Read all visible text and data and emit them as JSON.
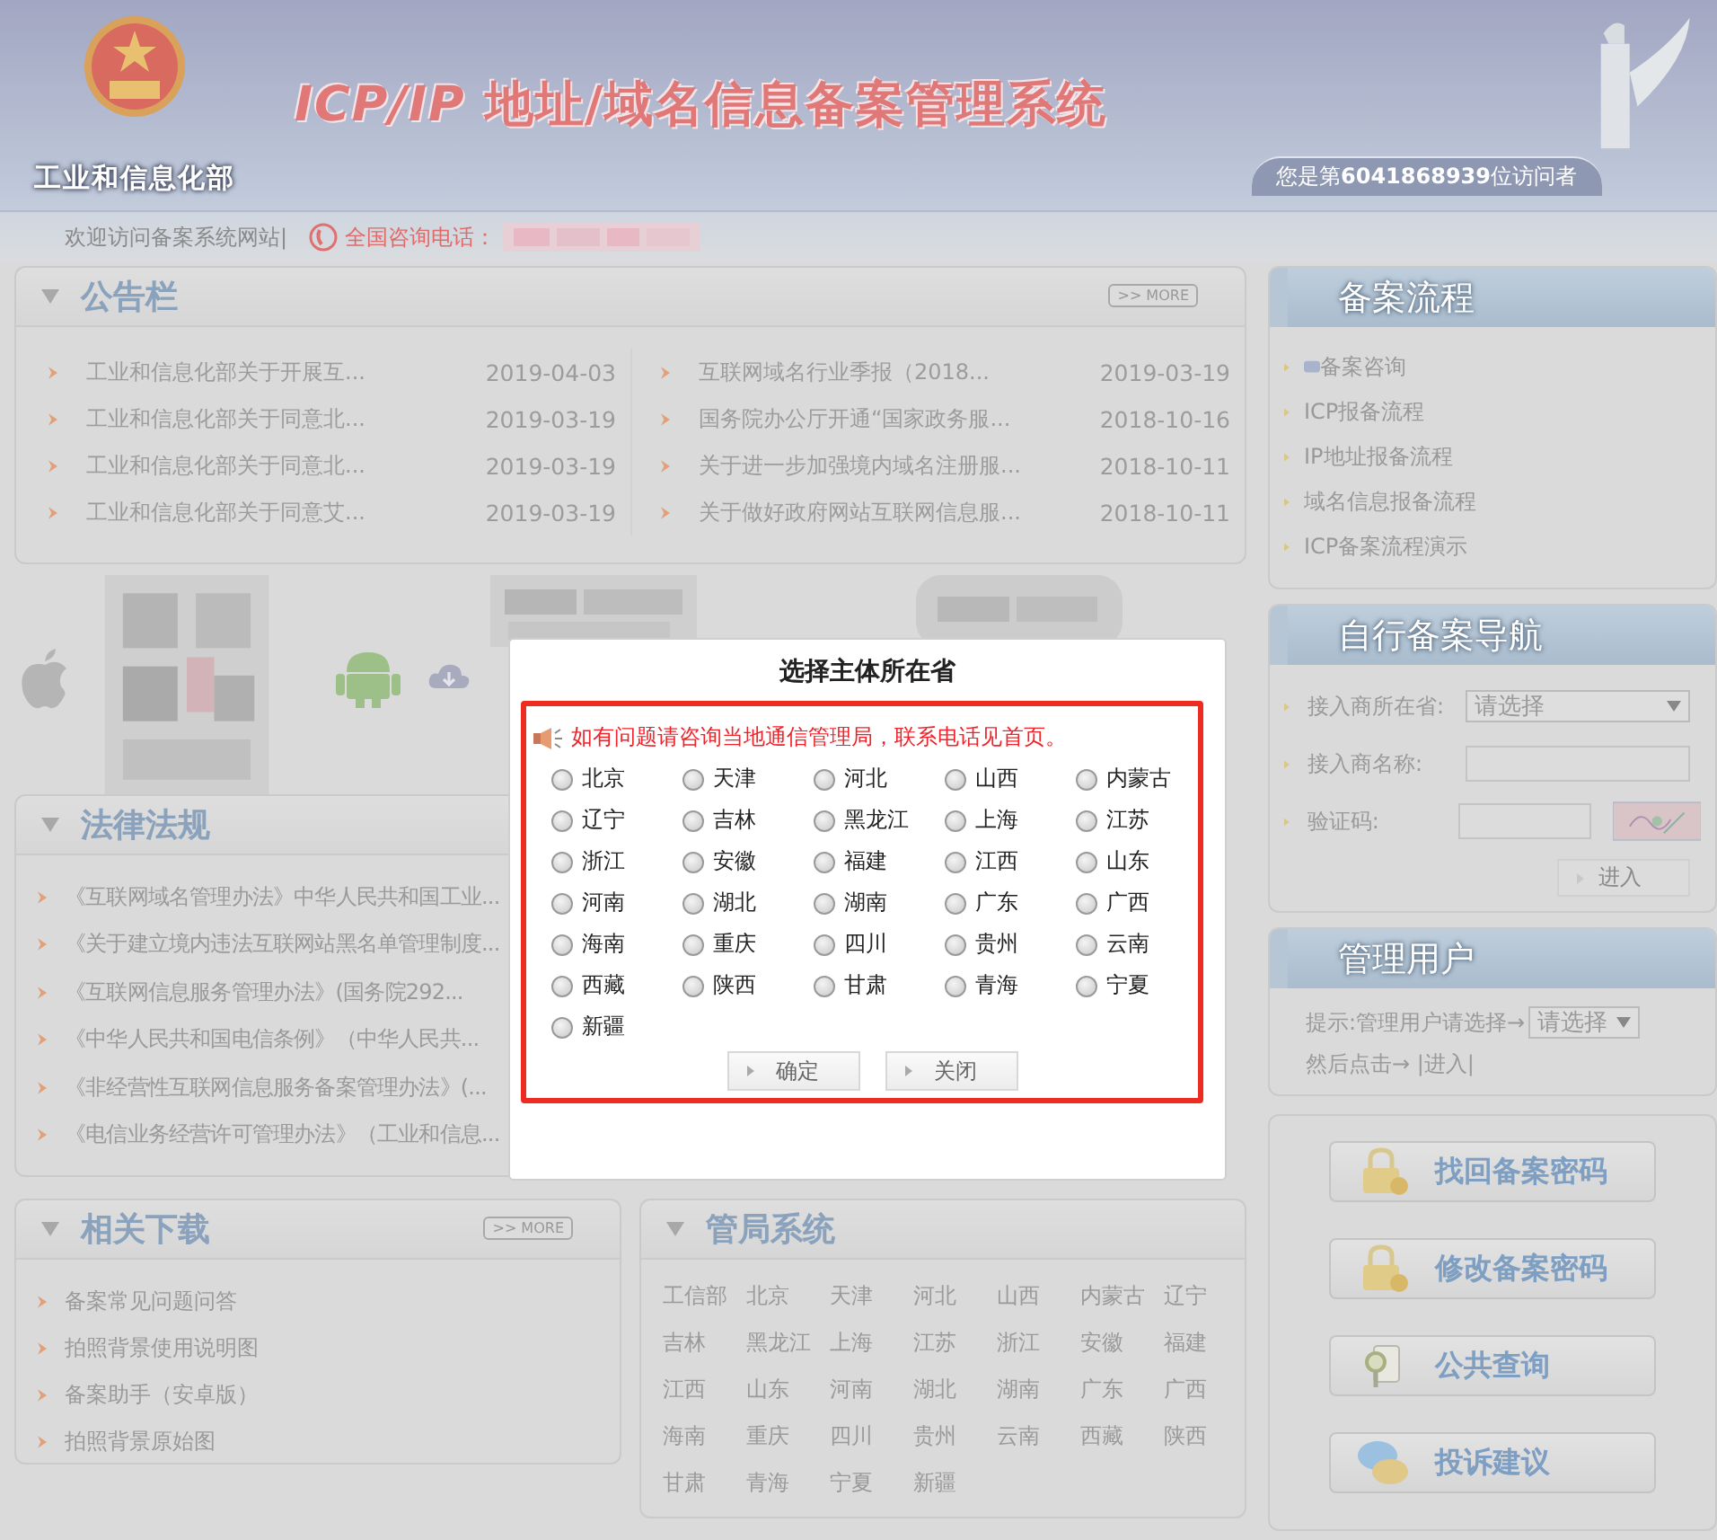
{
  "header": {
    "ministry": "工业和信息化部",
    "title": "*ICP/IP* 地址/域名信息备案管理系统",
    "visitor": "您是第**6041868939**位访问者"
  },
  "welcome_bar": {
    "welcome": "欢迎访问备案系统网站|",
    "hotline_label": "全国咨询电话："
  },
  "notices": {
    "title": "公告栏",
    "more": ">> MORE",
    "columns": [
      [
        {
          "title": "工业和信息化部关于开展互...",
          "date": "2019-04-03"
        },
        {
          "title": "工业和信息化部关于同意北...",
          "date": "2019-03-19"
        },
        {
          "title": "工业和信息化部关于同意北...",
          "date": "2019-03-19"
        },
        {
          "title": "工业和信息化部关于同意艾...",
          "date": "2019-03-19"
        }
      ],
      [
        {
          "title": "互联网域名行业季报（2018...",
          "date": "2019-03-19"
        },
        {
          "title": "国务院办公厅开通“国家政务服...",
          "date": "2018-10-16"
        },
        {
          "title": "关于进一步加强境内域名注册服...",
          "date": "2018-10-11"
        },
        {
          "title": "关于做好政府网站互联网信息服...",
          "date": "2018-10-11"
        }
      ]
    ]
  },
  "laws": {
    "title": "法律法规",
    "items": [
      "《互联网域名管理办法》中华人民共和国工业...",
      "《关于建立境内违法互联网站黑名单管理制度...",
      "《互联网信息服务管理办法》(国务院292...",
      "《中华人民共和国电信条例》（中华人民共...",
      "《非经营性互联网信息服务备案管理办法》(...",
      "《电信业务经营许可管理办法》（工业和信息..."
    ]
  },
  "downloads": {
    "title": "相关下载",
    "more": ">> MORE",
    "items": [
      "备案常见问题问答",
      "拍照背景使用说明图",
      "备案助手（安卓版）",
      "拍照背景原始图"
    ]
  },
  "bureaus": {
    "title": "管局系统",
    "items": [
      "工信部",
      "北京",
      "天津",
      "河北",
      "山西",
      "内蒙古",
      "辽宁",
      "吉林",
      "黑龙江",
      "上海",
      "江苏",
      "浙江",
      "安徽",
      "福建",
      "江西",
      "山东",
      "河南",
      "湖北",
      "湖南",
      "广东",
      "广西",
      "海南",
      "重庆",
      "四川",
      "贵州",
      "云南",
      "西藏",
      "陕西",
      "甘肃",
      "青海",
      "宁夏",
      "新疆"
    ]
  },
  "flow": {
    "title": "备案流程",
    "items": [
      "备案咨询",
      "ICP报备流程",
      "IP地址报备流程",
      "域名信息报备流程",
      "ICP备案流程演示"
    ]
  },
  "self_nav": {
    "title": "自行备案导航",
    "province_label": "接入商所在省:",
    "province_value": "请选择",
    "name_label": "接入商名称:",
    "captcha_label": "验证码:",
    "enter": "进入"
  },
  "users": {
    "title": "管理用户",
    "hint": "提示:管理用户请选择→",
    "select_value": "请选择",
    "then": "然后点击→ |进入|"
  },
  "actions": [
    {
      "kind": "lock",
      "label": "找回备案密码"
    },
    {
      "kind": "lock",
      "label": "修改备案密码"
    },
    {
      "kind": "search",
      "label": "公共查询"
    },
    {
      "kind": "chat",
      "label": "投诉建议"
    }
  ],
  "modal": {
    "title": "选择主体所在省",
    "notice": "如有问题请咨询当地通信管理局，联系电话见首页。",
    "ok": "确定",
    "close": "关闭",
    "provinces": [
      {
        "name": "北京",
        "selected": false
      },
      {
        "name": "天津",
        "selected": false
      },
      {
        "name": "河北",
        "selected": false
      },
      {
        "name": "山西",
        "selected": false
      },
      {
        "name": "内蒙古",
        "selected": false
      },
      {
        "name": "辽宁",
        "selected": false
      },
      {
        "name": "吉林",
        "selected": false
      },
      {
        "name": "黑龙江",
        "selected": false
      },
      {
        "name": "上海",
        "selected": false
      },
      {
        "name": "江苏",
        "selected": false
      },
      {
        "name": "浙江",
        "selected": false
      },
      {
        "name": "安徽",
        "selected": false
      },
      {
        "name": "福建",
        "selected": false
      },
      {
        "name": "江西",
        "selected": false
      },
      {
        "name": "山东",
        "selected": false
      },
      {
        "name": "河南",
        "selected": false
      },
      {
        "name": "湖北",
        "selected": false
      },
      {
        "name": "湖南",
        "selected": false
      },
      {
        "name": "广东",
        "selected": false
      },
      {
        "name": "广西",
        "selected": false
      },
      {
        "name": "海南",
        "selected": false
      },
      {
        "name": "重庆",
        "selected": false
      },
      {
        "name": "四川",
        "selected": false
      },
      {
        "name": "贵州",
        "selected": false
      },
      {
        "name": "云南",
        "selected": false
      },
      {
        "name": "西藏",
        "selected": false
      },
      {
        "name": "陕西",
        "selected": false
      },
      {
        "name": "甘肃",
        "selected": false
      },
      {
        "name": "青海",
        "selected": false
      },
      {
        "name": "宁夏",
        "selected": false
      },
      {
        "name": "新疆",
        "selected": false
      }
    ]
  }
}
